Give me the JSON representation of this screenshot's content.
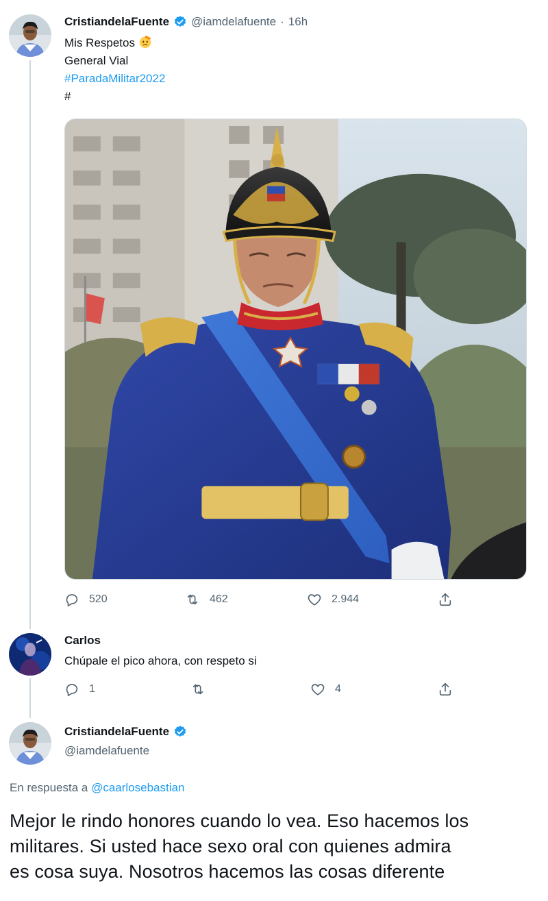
{
  "tweet1": {
    "display_name": "CristiandelaFuente",
    "handle": "@iamdelafuente",
    "separator": "·",
    "time": "16h",
    "text_line1": "Mis Respetos",
    "text_line2": "General Vial",
    "hashtag": "#ParadaMilitar2022",
    "text_line4": "#",
    "emoji": "saluting-face-icon",
    "actions": {
      "replies": "520",
      "retweets": "462",
      "likes": "2.944"
    }
  },
  "reply1": {
    "display_name": "Carlos",
    "text": "Chúpale el pico ahora, con respeto si",
    "actions": {
      "replies": "1",
      "retweets": "",
      "likes": "4"
    }
  },
  "tweet2": {
    "display_name": "CristiandelaFuente",
    "handle": "@iamdelafuente",
    "reply_prefix": "En respuesta a",
    "reply_mention": "@caarlosebastian",
    "text_line1": "Mejor le rindo honores cuando lo vea. Eso hacemos los",
    "text_line2": "militares. Si usted hace sexo oral con quienes admira",
    "text_line3": "es cosa suya. Nosotros hacemos las cosas diferente"
  },
  "colors": {
    "accent": "#1d9bf0",
    "text": "#0f1419",
    "muted": "#536471",
    "line": "#cfd9de"
  },
  "icons": [
    "reply-icon",
    "retweet-icon",
    "like-icon",
    "share-icon",
    "verified-icon"
  ]
}
